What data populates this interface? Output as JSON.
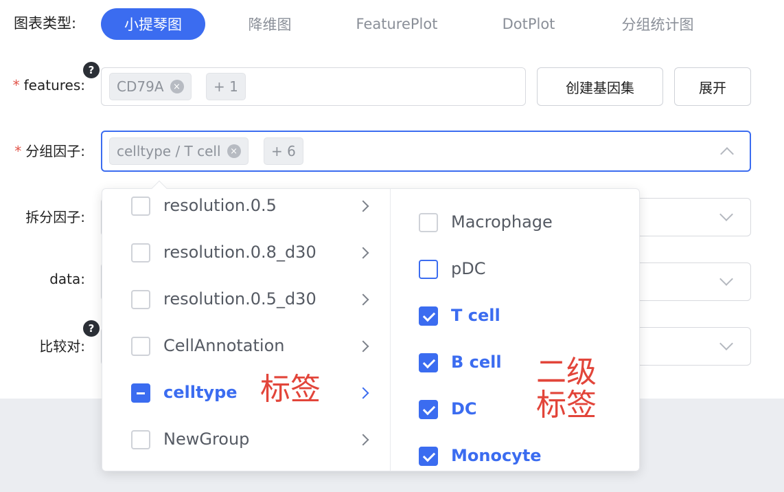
{
  "chart_type_label": "图表类型:",
  "tabs": [
    {
      "label": "小提琴图",
      "active": true
    },
    {
      "label": "降维图",
      "active": false
    },
    {
      "label": "FeaturePlot",
      "active": false
    },
    {
      "label": "DotPlot",
      "active": false
    },
    {
      "label": "分组统计图",
      "active": false
    }
  ],
  "required_mark": "*",
  "features": {
    "label": "features:",
    "help_glyph": "?",
    "tag": "CD79A",
    "more": "+ 1",
    "create_button": "创建基因集",
    "expand_button": "展开"
  },
  "group_factor": {
    "label": "分组因子:",
    "tag": "celltype / T cell",
    "more": "+ 6"
  },
  "split_factor": {
    "label": "拆分因子:"
  },
  "data_field": {
    "label": "data:"
  },
  "compare_pairs": {
    "label": "比较对:",
    "help_glyph": "?"
  },
  "tag_close_glyph": "×",
  "dropdown": {
    "level1": [
      {
        "label": "resolution.0.5",
        "state": "unchecked"
      },
      {
        "label": "resolution.0.8_d30",
        "state": "unchecked"
      },
      {
        "label": "resolution.0.5_d30",
        "state": "unchecked"
      },
      {
        "label": "CellAnnotation",
        "state": "unchecked"
      },
      {
        "label": "celltype",
        "state": "partial"
      },
      {
        "label": "NewGroup",
        "state": "unchecked"
      }
    ],
    "level2": [
      {
        "label": "Macrophage",
        "state": "unchecked"
      },
      {
        "label": "pDC",
        "state": "unchecked"
      },
      {
        "label": "T cell",
        "state": "checked"
      },
      {
        "label": "B cell",
        "state": "checked"
      },
      {
        "label": "DC",
        "state": "checked"
      },
      {
        "label": "Monocyte",
        "state": "checked"
      }
    ]
  },
  "annotations": {
    "level1": "标签",
    "level2_line1": "二级",
    "level2_line2": "标签"
  },
  "colors": {
    "accent": "#3b6cf0",
    "required": "#e2554a",
    "annotation": "#e2453a"
  }
}
